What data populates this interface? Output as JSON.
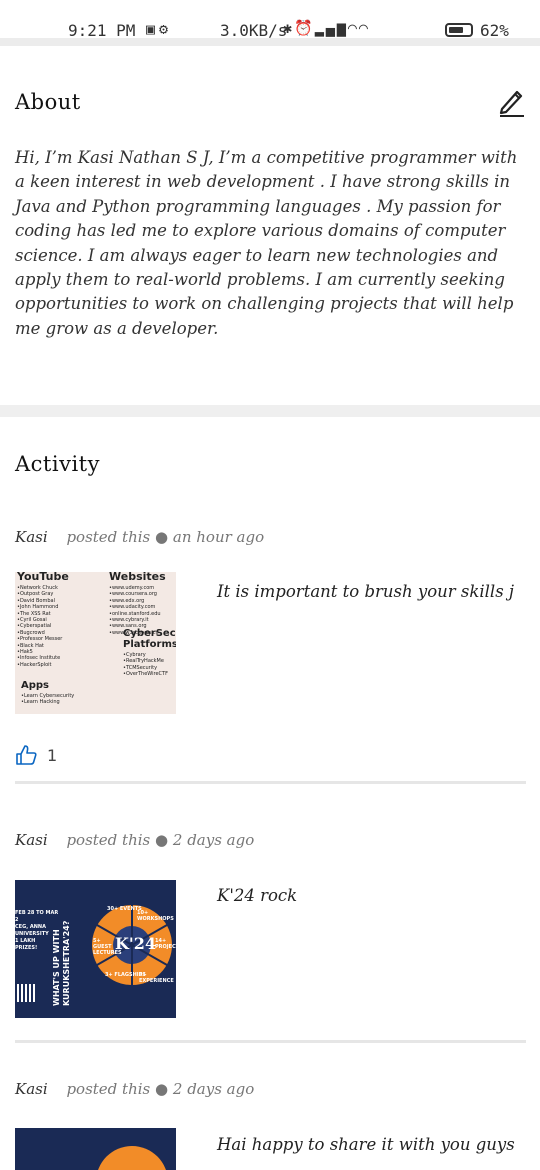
{
  "status_bar": {
    "time": "9:21 PM",
    "net_speed": "3.0KB/s",
    "battery": "62%",
    "icons_left": [
      "sim-icon",
      "gear-icon"
    ],
    "icons_right": [
      "bluetooth-icon",
      "alarm-icon",
      "volte-icon",
      "signal-icon",
      "wifi-icon",
      "wifi-icon",
      "battery-icon"
    ]
  },
  "about": {
    "title": "About",
    "body": "Hi, I’m Kasi Nathan S J, I’m a competitive programmer with a keen interest in web development . I have strong skills in Java and Python programming languages . My passion for coding has led me to explore various domains of computer science. I am always eager to learn new technologies and apply them to real-world problems. I am currently seeking opportunities to work on challenging projects that will help me grow as a developer."
  },
  "activity": {
    "title": "Activity",
    "posts": [
      {
        "author": "Kasi",
        "posted": "posted this",
        "dot": "●",
        "time": "an hour ago",
        "text": "It is important to brush your skills j",
        "likes": "1",
        "thumb": {
          "youtube_head": "YouTube",
          "youtube_list": [
            "•Network Chuck",
            "•Outpost Gray",
            "•David Bombal",
            "•John Hammond",
            "•The XSS Rat",
            "•Cyril Gosai",
            "•Cyberspatial",
            "•Bugcrowd",
            "•Professor Messer",
            "•Black Hat",
            "•Hak5",
            "•Infosec Institute",
            "•HackerSploit"
          ],
          "websites_head": "Websites",
          "websites_list": [
            "•www.udemy.com",
            "•www.coursera.org",
            "•www.edx.org",
            "•www.udacity.com",
            "•online.stanford.edu",
            "•www.cybrary.it",
            "•www.sans.org",
            "•www.w3schools.co"
          ],
          "apps_head": "Apps",
          "apps_list": [
            "•Learn Cybersecurity",
            "•Learn Hacking"
          ],
          "platforms_head": "CyberSec Platforms",
          "platforms_list": [
            "•Cybrary",
            "•RealTryHackMe",
            "•TCMSecurity",
            "•OverTheWireCTF"
          ]
        }
      },
      {
        "author": "Kasi",
        "posted": "posted this",
        "dot": "●",
        "time": "2 days ago",
        "text": "K'24 rock",
        "thumb": {
          "vertical": "WHAT'S UP WITH KURUKSHETRA'24?",
          "center": "K'24",
          "stats": [
            "30+ EVENTS",
            "10+ WORKSHOPS",
            "5+ GUEST LECTURES",
            "14+ PROJECTS",
            "3+ FLAGSHIPS",
            "5+ EXPERIENCE"
          ],
          "left": [
            "FEB 28 TO MAR 2",
            "CEG, ANNA UNIVERSITY",
            "1 LAKH PRIZES!"
          ]
        }
      },
      {
        "author": "Kasi",
        "posted": "posted this",
        "dot": "●",
        "time": "2 days ago",
        "text": "Hai happy to share it with you guys"
      }
    ]
  },
  "colors": {
    "accent": "#0a66c2",
    "divider": "#efefef",
    "thumb_dark": "#1a2a55",
    "thumb_orange": "#f28c28"
  }
}
